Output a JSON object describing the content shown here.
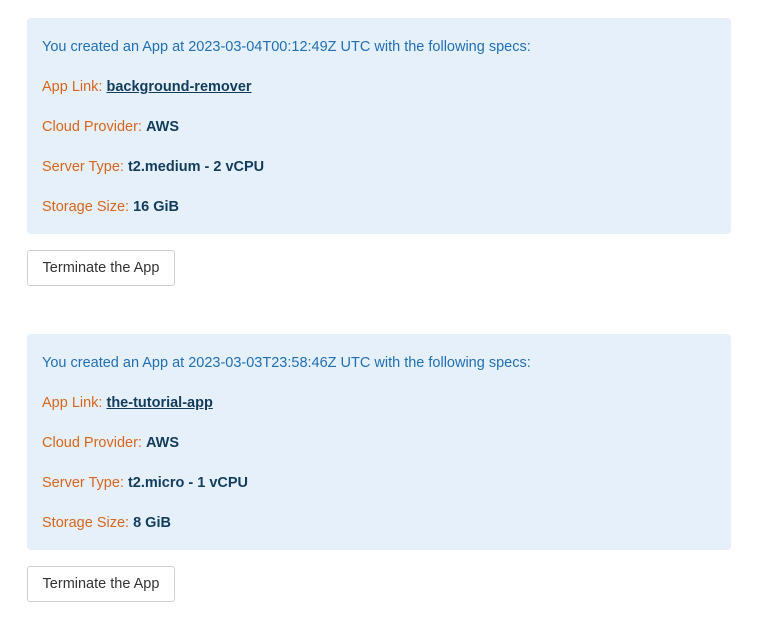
{
  "apps": [
    {
      "intro": "You created an App at 2023-03-04T00:12:49Z UTC with the following specs:",
      "app_link_label": "App Link: ",
      "app_link_value": "background-remover",
      "cloud_label": "Cloud Provider: ",
      "cloud_value": "AWS",
      "server_label": "Server Type: ",
      "server_value": "t2.medium - 2 vCPU",
      "storage_label": "Storage Size: ",
      "storage_value": "16 GiB",
      "button_label": "Terminate the App"
    },
    {
      "intro": "You created an App at 2023-03-03T23:58:46Z UTC with the following specs:",
      "app_link_label": "App Link: ",
      "app_link_value": "the-tutorial-app",
      "cloud_label": "Cloud Provider: ",
      "cloud_value": "AWS",
      "server_label": "Server Type: ",
      "server_value": "t2.micro - 1 vCPU",
      "storage_label": "Storage Size: ",
      "storage_value": "8 GiB",
      "button_label": "Terminate the App"
    }
  ],
  "colors": {
    "box_background": "#e6f0fb",
    "intro_text": "#1f6fb4",
    "label_text": "#d9651c",
    "value_text": "#113c5c"
  }
}
